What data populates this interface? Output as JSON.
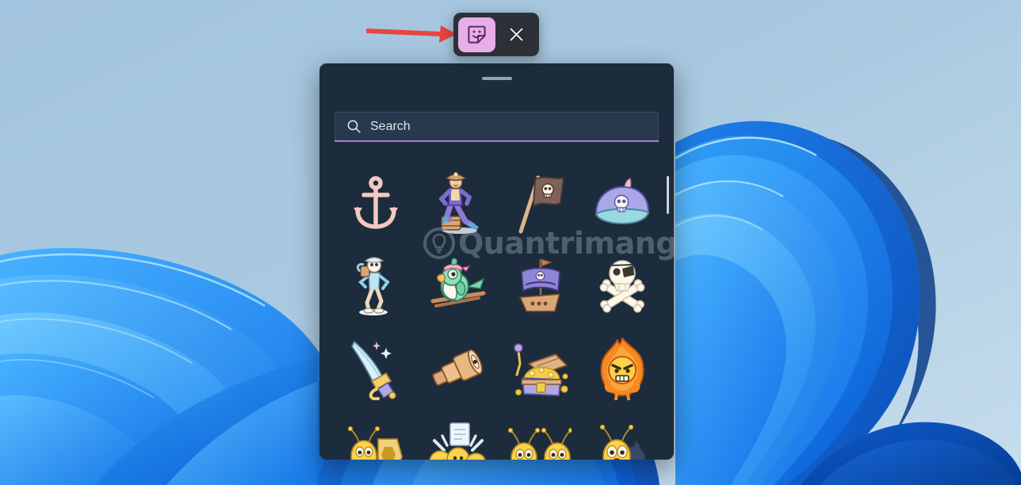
{
  "desktop": {
    "wallpaper_name": "windows-11-bloom-wallpaper",
    "background_color": "#9cc0dc"
  },
  "toolbar": {
    "name": "floating-sticker-toolbar",
    "background_color": "#2c3137",
    "sticker_button": {
      "label": "Stickers",
      "icon": "sticker-icon",
      "active": true,
      "accent_color": "#e8aee8",
      "glyph_color": "#5a2a6a"
    },
    "close_button": {
      "label": "Close",
      "icon": "close-icon",
      "glyph_color": "#ffffff"
    }
  },
  "annotation": {
    "arrow": {
      "name": "red-pointer-arrow",
      "color": "#e8453c",
      "direction": "right",
      "points_to": "sticker-button"
    }
  },
  "panel": {
    "name": "sticker-picker-panel",
    "background_color": "#1c2c3d",
    "drag_handle": {
      "name": "drag-handle",
      "color": "#93a3b1"
    },
    "search": {
      "placeholder": "Search",
      "value": "",
      "icon": "search-icon",
      "accent_color": "#b07dd0",
      "field_color": "#27394c"
    },
    "scrollbar": {
      "name": "vertical-scrollbar",
      "color": "#c9d3dc"
    },
    "stickers": [
      {
        "name": "anchor",
        "label": "Anchor"
      },
      {
        "name": "pirate-captain",
        "label": "Pirate captain"
      },
      {
        "name": "pirate-flag",
        "label": "Pirate flag"
      },
      {
        "name": "pirate-hat",
        "label": "Pirate hat"
      },
      {
        "name": "pirate-skeleton",
        "label": "Pirate skeleton"
      },
      {
        "name": "parrot",
        "label": "Parrot"
      },
      {
        "name": "pirate-ship",
        "label": "Pirate ship"
      },
      {
        "name": "skull-and-crossbones",
        "label": "Skull and crossbones"
      },
      {
        "name": "cutlass-sword",
        "label": "Cutlass sword"
      },
      {
        "name": "telescope",
        "label": "Telescope"
      },
      {
        "name": "treasure-chest",
        "label": "Treasure chest"
      },
      {
        "name": "angry-fire-face",
        "label": "Angry fire face"
      },
      {
        "name": "bee-with-honeycomb",
        "label": "Bee with honeycomb"
      },
      {
        "name": "bees-celebrating",
        "label": "Bees celebrating"
      },
      {
        "name": "two-bees-gift",
        "label": "Two bees with gift"
      },
      {
        "name": "scared-bee",
        "label": "Scared bee"
      }
    ]
  },
  "watermark": {
    "text": "Quantrimang",
    "icon": "lightbulb-circle-icon",
    "color": "#c9d6e2"
  }
}
